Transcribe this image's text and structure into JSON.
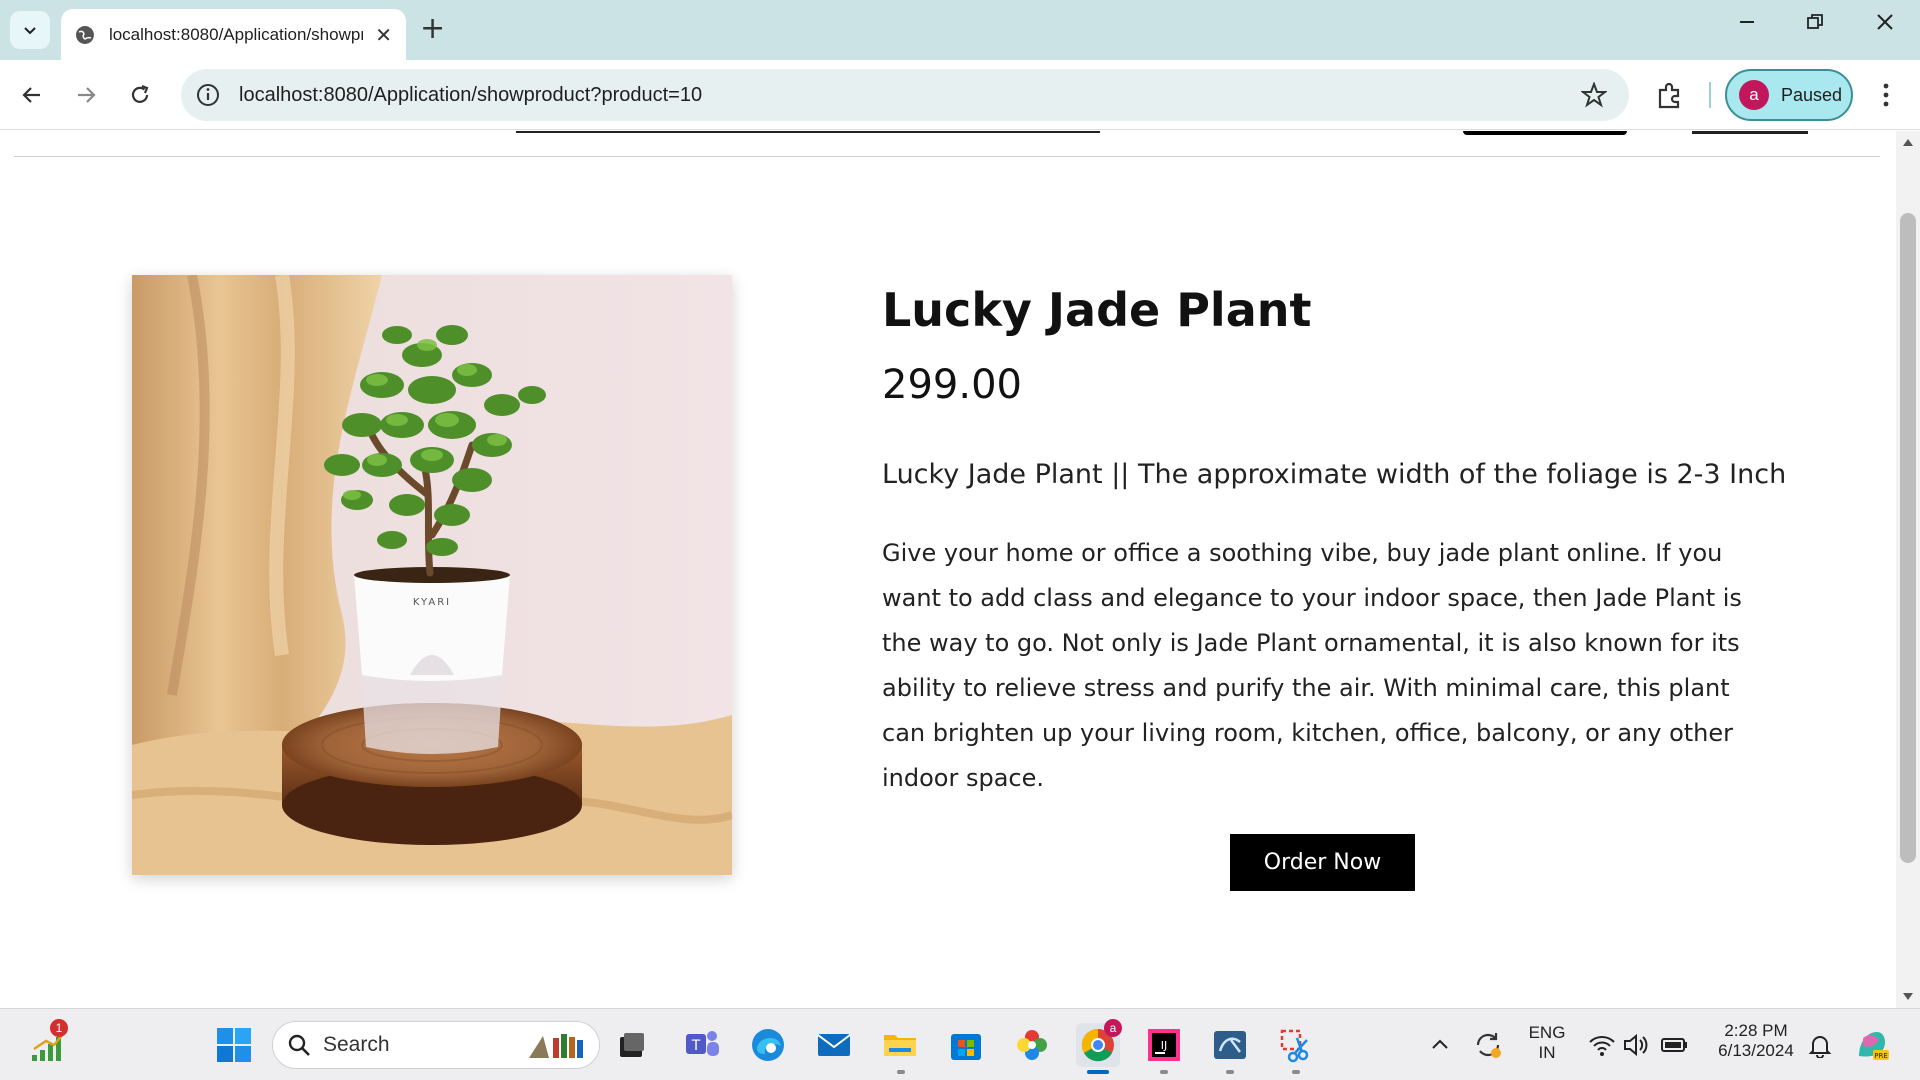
{
  "browser": {
    "tab_title": "localhost:8080/Application/showproduct?product=10",
    "new_tab_label": "+",
    "address_url": "localhost:8080/Application/showproduct?product=10",
    "profile_initial": "a",
    "profile_status": "Paused"
  },
  "product": {
    "name": "Lucky Jade Plant",
    "price": "299.00",
    "subtitle": "Lucky Jade Plant || The approximate width of the foliage is 2-3 Inch",
    "description": "Give your home or office a soothing vibe, buy jade plant online. If you want to add class and elegance to your indoor space, then Jade Plant is the way to go. Not only is Jade Plant ornamental, it is also known for its ability to relieve stress and purify the air. With minimal care, this plant can brighten up your living room, kitchen, office, balcony, or any other indoor space.",
    "order_button": "Order Now",
    "pot_brand": "KYARI"
  },
  "taskbar": {
    "search_placeholder": "Search",
    "notification_count": "1",
    "chrome_badge": "a",
    "language_line1": "ENG",
    "language_line2": "IN",
    "time": "2:28 PM",
    "date": "6/13/2024"
  },
  "colors": {
    "tabbar_bg": "#cce3e6",
    "omnibox_bg": "#e6f0f1",
    "profile_bg": "#a8e8ee",
    "button_bg": "#000000",
    "button_text": "#ffffff"
  }
}
